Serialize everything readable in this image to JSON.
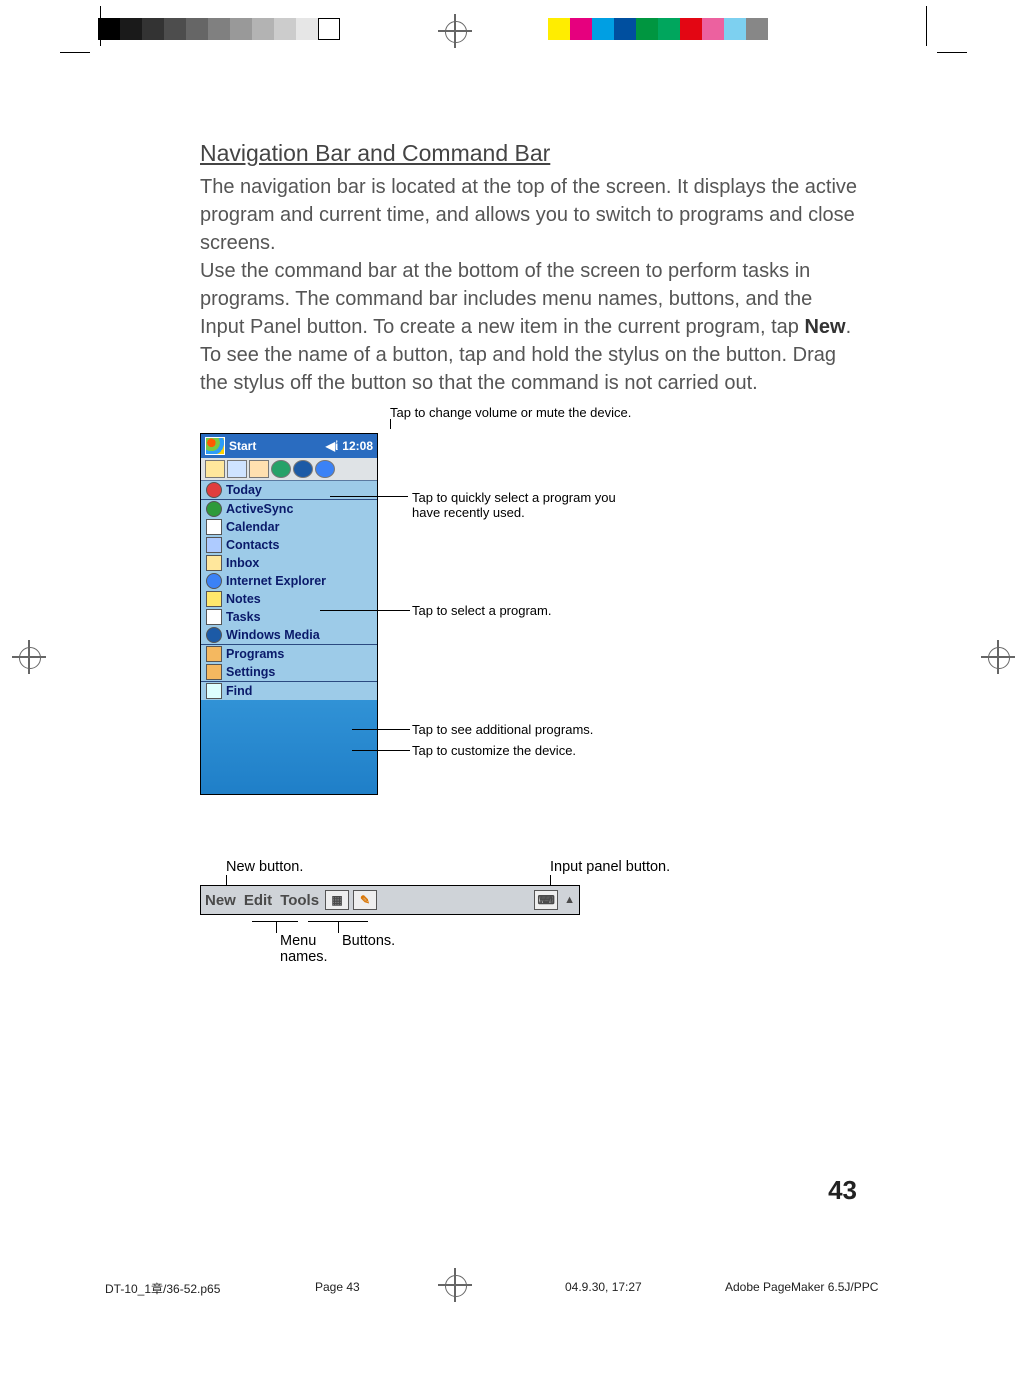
{
  "section_title": "Navigation Bar and Command Bar",
  "para1": "The navigation bar is located at the top of the screen. It displays the active program and current time, and allows you to switch to programs and close screens.",
  "para2a": "Use the command bar at the bottom of the screen to perform tasks in programs. The command bar includes menu names, buttons, and the Input Panel button. To create a new item in the current program, tap ",
  "para2_bold": "New",
  "para2b": ". To see the name of a button, tap and hold the stylus on the button. Drag the stylus off the button so that the command is not carried out.",
  "fig1": {
    "top_annotation": "Tap to change volume or mute the device.",
    "titlebar": {
      "start": "Start",
      "time": "12:08"
    },
    "menu_items": [
      "Today",
      "ActiveSync",
      "Calendar",
      "Contacts",
      "Inbox",
      "Internet Explorer",
      "Notes",
      "Tasks",
      "Windows Media"
    ],
    "footer_items": [
      "Programs",
      "Settings"
    ],
    "find_item": "Find",
    "callouts": {
      "recent": "Tap to quickly select a program you have recently used.",
      "select": "Tap to select a program.",
      "programs": "Tap to see additional programs.",
      "settings": "Tap to customize the device."
    }
  },
  "fig2": {
    "new_label": "New button.",
    "input_label": "Input panel button.",
    "menus": [
      "New",
      "Edit",
      "Tools"
    ],
    "menu_names_label": "Menu names.",
    "buttons_label": "Buttons."
  },
  "page_number": "43",
  "footer": {
    "file": "DT-10_1章/36-52.p65",
    "page": "Page 43",
    "date": "04.9.30, 17:27",
    "app": "Adobe PageMaker 6.5J/PPC"
  }
}
